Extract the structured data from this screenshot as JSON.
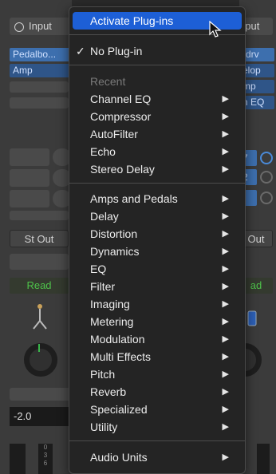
{
  "strip": {
    "input_label": "Input",
    "input_label_right": "nput",
    "plugin_slots_left": [
      "Pedalbo...",
      "Amp"
    ],
    "plugin_slots_right": [
      "rdrv",
      "elop",
      "mp",
      "n EQ"
    ],
    "send_values_right": [
      "7",
      "2"
    ],
    "output_left": "St Out",
    "output_right": "Out",
    "automation_left": "Read",
    "automation_right": "ad",
    "volume_value": "-2.0",
    "meter_scale": [
      "0",
      "3",
      "6"
    ]
  },
  "menu": {
    "activate": "Activate Plug-ins",
    "no_plugin": "No Plug-in",
    "no_plugin_check": "✓",
    "recent_header": "Recent",
    "recent": [
      "Channel EQ",
      "Compressor",
      "AutoFilter",
      "Echo",
      "Stereo Delay"
    ],
    "categories": [
      "Amps and Pedals",
      "Delay",
      "Distortion",
      "Dynamics",
      "EQ",
      "Filter",
      "Imaging",
      "Metering",
      "Modulation",
      "Multi Effects",
      "Pitch",
      "Reverb",
      "Specialized",
      "Utility"
    ],
    "audio_units": "Audio Units"
  },
  "colors": {
    "highlight": "#1d5fd6",
    "read_green": "#4ec24a",
    "plugin_blue": "#3d6fae"
  }
}
